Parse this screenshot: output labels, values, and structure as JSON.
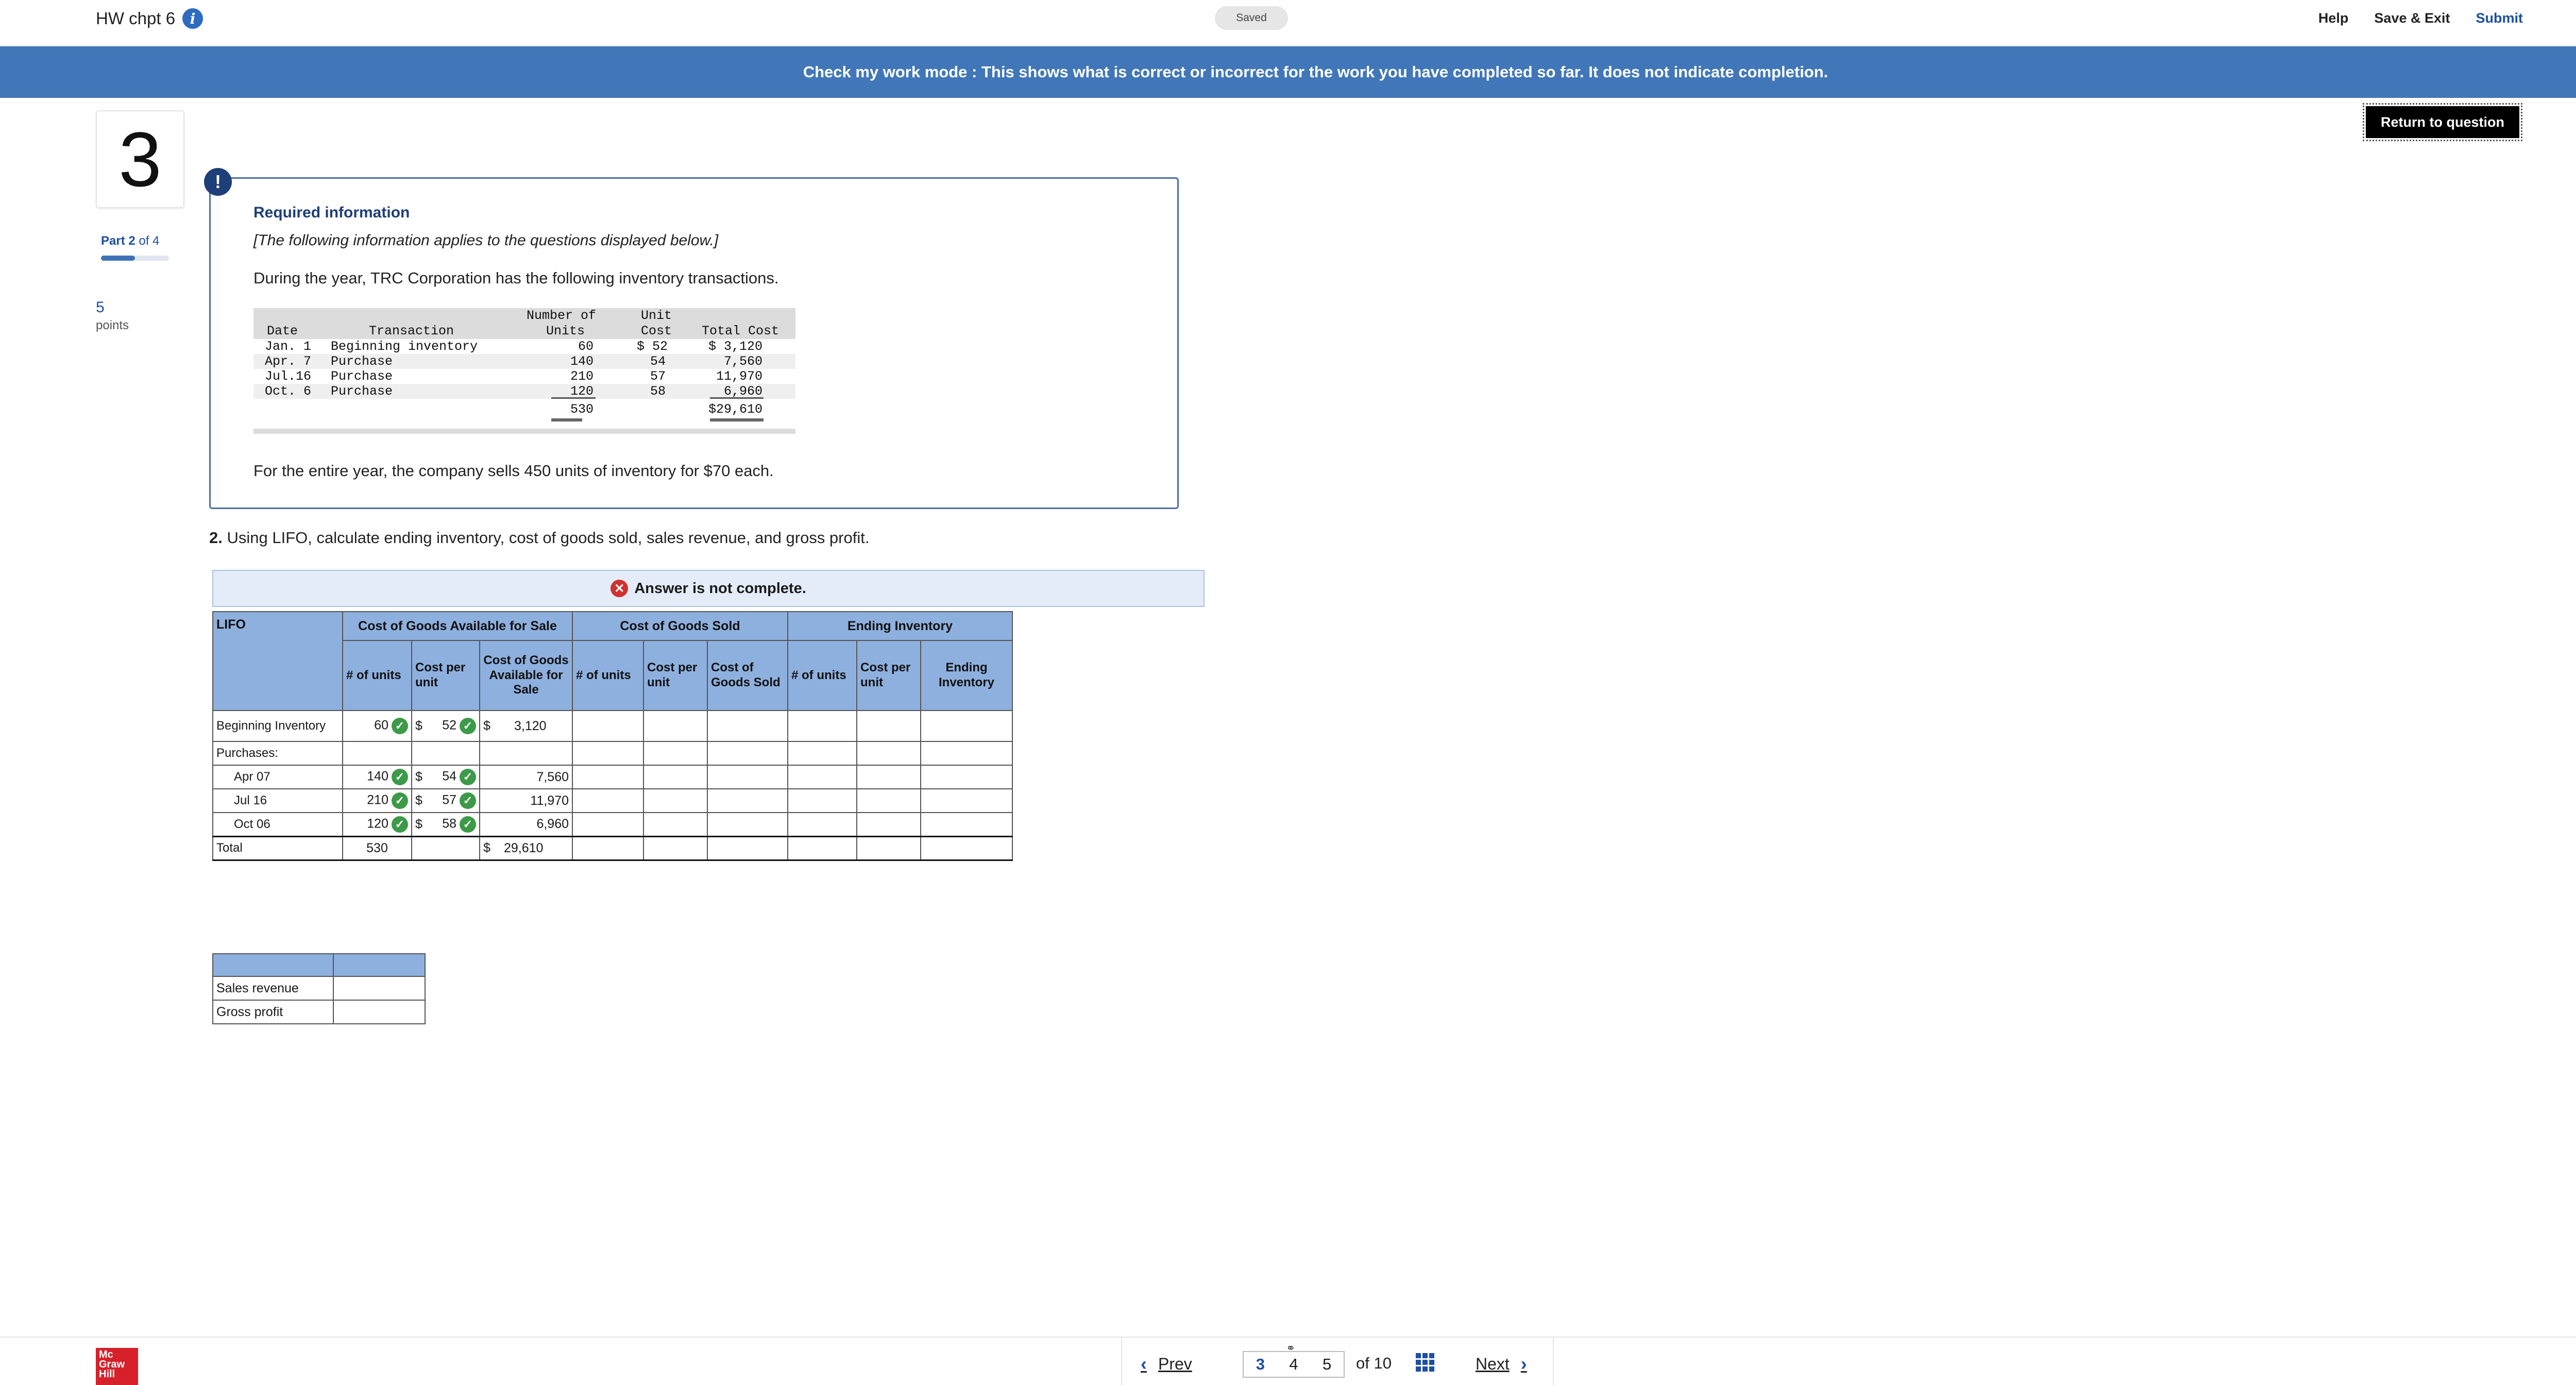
{
  "header": {
    "title": "HW chpt 6",
    "info_icon": "info-icon",
    "saved": "Saved",
    "help": "Help",
    "save_exit": "Save & Exit",
    "submit": "Submit"
  },
  "banner": {
    "text": "Check my work mode : This shows what is correct or incorrect for the work you have completed so far. It does not indicate completion."
  },
  "return_button": "Return to question",
  "question": {
    "number": "3",
    "part_label_bold": "Part 2",
    "part_label_rest": " of 4",
    "part_progress": 0.5,
    "points": "5",
    "points_label": "points"
  },
  "required_info": {
    "alert_glyph": "!",
    "title": "Required information",
    "italic_note": "[The following information applies to the questions displayed below.]",
    "intro": "During the year, TRC Corporation has the following inventory transactions.",
    "table": {
      "headers": {
        "date": "Date",
        "transaction": "Transaction",
        "units_top": "Number of",
        "units_bottom": "Units",
        "cost_top": "Unit",
        "cost_bottom": "Cost",
        "total": "Total Cost"
      },
      "rows": [
        {
          "date": "Jan. 1",
          "transaction": "Beginning inventory",
          "units": "60",
          "cost": "$ 52",
          "total": "$ 3,120"
        },
        {
          "date": "Apr. 7",
          "transaction": "Purchase",
          "units": "140",
          "cost": "54",
          "total": "7,560"
        },
        {
          "date": "Jul.16",
          "transaction": "Purchase",
          "units": "210",
          "cost": "57",
          "total": "11,970"
        },
        {
          "date": "Oct. 6",
          "transaction": "Purchase",
          "units": "120",
          "cost": "58",
          "total": "6,960"
        }
      ],
      "total_units": "530",
      "total_cost": "$29,610"
    },
    "tail": "For the entire year, the company sells 450 units of inventory for $70 each."
  },
  "prompt": {
    "bold": "2.",
    "text": " Using LIFO, calculate ending inventory, cost of goods sold, sales revenue, and gross profit."
  },
  "status": {
    "icon": "x-icon",
    "text": "Answer is not complete."
  },
  "lifo_table": {
    "corner": "LIFO",
    "groups": [
      "Cost of Goods Available for Sale",
      "Cost of Goods Sold",
      "Ending Inventory"
    ],
    "sub": {
      "units": "# of units",
      "cost": "Cost per unit",
      "cgas": "Cost of Goods Available for Sale",
      "cogs": "Cost of Goods Sold",
      "ei": "Ending Inventory"
    },
    "rows": {
      "beginning": {
        "label": "Beginning Inventory",
        "units": "60",
        "cost": "52",
        "cgas": "3,120"
      },
      "purchases_label": "Purchases:",
      "apr": {
        "label": "Apr 07",
        "units": "140",
        "cost": "54",
        "cgas": "7,560"
      },
      "jul": {
        "label": "Jul 16",
        "units": "210",
        "cost": "57",
        "cgas": "11,970"
      },
      "oct": {
        "label": "Oct 06",
        "units": "120",
        "cost": "58",
        "cgas": "6,960"
      },
      "total": {
        "label": "Total",
        "units": "530",
        "cgas": "29,610"
      }
    },
    "dollar": "$"
  },
  "sales_table": {
    "rows": [
      "Sales revenue",
      "Gross profit"
    ]
  },
  "footer": {
    "logo": "Mc Graw Hill Education",
    "prev": "Prev",
    "pages": [
      "3",
      "4",
      "5"
    ],
    "current_page": "3",
    "of_label": "of 10",
    "next": "Next"
  },
  "colors": {
    "banner": "#4177b8",
    "header_blue": "#8eb0de",
    "check_green": "#3d9a48",
    "error_red": "#d0322f",
    "link_blue": "#1d4fa3"
  }
}
